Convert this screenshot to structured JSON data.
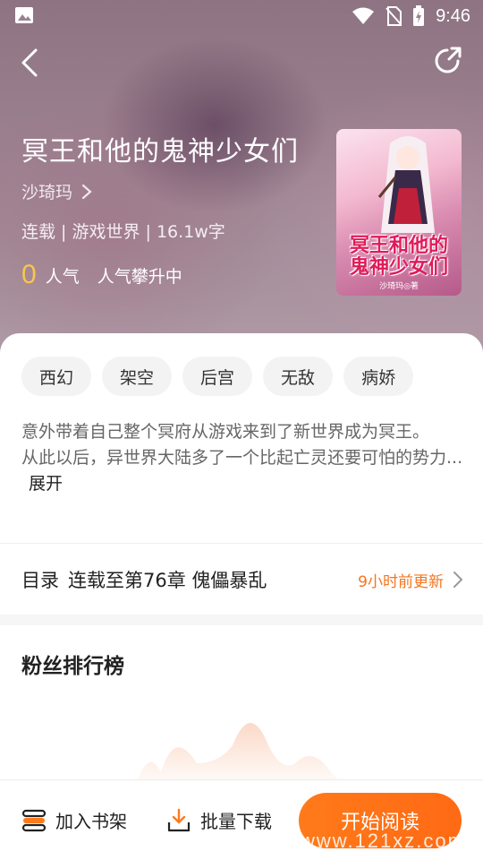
{
  "status_bar": {
    "time": "9:46",
    "icons": [
      "image-icon",
      "wifi-icon",
      "no-sim-icon",
      "battery-charging-icon"
    ]
  },
  "header": {
    "back_icon": "back-arrow-icon",
    "share_icon": "share-icon"
  },
  "book": {
    "title": "冥王和他的鬼神少女们",
    "author": "沙琦玛",
    "meta": "连载 | 游戏世界 | 16.1w字",
    "popularity_value": "0",
    "popularity_label": "人气",
    "popularity_status": "人气攀升中",
    "cover": {
      "title": "冥王和他的鬼神少女们",
      "author_line": "沙琦玛◎著"
    }
  },
  "tags": [
    "西幻",
    "架空",
    "后宫",
    "无敌",
    "病娇"
  ],
  "synopsis": {
    "text": "意外带着自己整个冥府从游戏来到了新世界成为冥王。\n从此以后，异世界大陆多了一个比起亡灵还要可怕的势力...",
    "expand_label": "展开"
  },
  "toc": {
    "label": "目录",
    "chapter": "连载至第76章 傀儡暴乱",
    "update": "9小时前更新"
  },
  "fans": {
    "title": "粉丝排行榜"
  },
  "bottom_bar": {
    "shelf_label": "加入书架",
    "download_label": "批量下载",
    "read_label": "开始阅读"
  },
  "watermark": "www.121xz.com",
  "colors": {
    "accent": "#ff7a1a",
    "update_text": "#f5751f",
    "popularity_number": "#f7c64f"
  }
}
